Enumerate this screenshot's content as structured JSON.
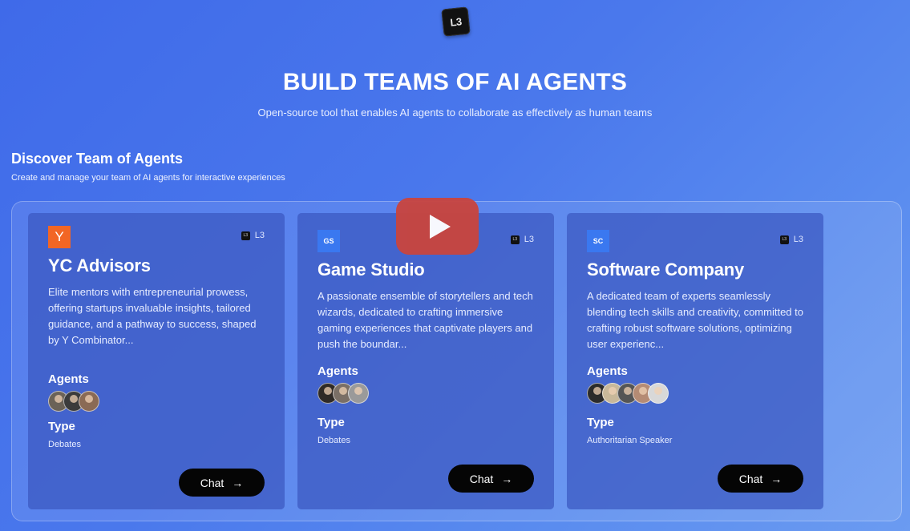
{
  "logo": {
    "text": "L3"
  },
  "hero": {
    "title": "BUILD TEAMS OF AI AGENTS",
    "subtitle": "Open-source tool that enables AI agents to collaborate as effectively as human teams"
  },
  "section": {
    "title": "Discover Team of Agents",
    "subtitle": "Create and manage your team of AI agents for interactive experiences"
  },
  "video": {
    "icon": "play-icon"
  },
  "labels": {
    "agents": "Agents",
    "type": "Type",
    "chat": "Chat",
    "arrow": "→",
    "brand": "L3"
  },
  "cards": [
    {
      "badge": "Y",
      "badge_color": "#f26625",
      "title": "YC Advisors",
      "description": "Elite mentors with entrepreneurial prowess, offering startups invaluable insights, tailored guidance, and a pathway to success, shaped by Y Combinator...",
      "agent_count": 3,
      "type": "Debates"
    },
    {
      "badge": "GS",
      "badge_color": "#3a78f0",
      "title": "Game Studio",
      "description": "A passionate ensemble of storytellers and tech wizards, dedicated to crafting immersive gaming experiences that captivate players and push the boundar...",
      "agent_count": 3,
      "type": "Debates"
    },
    {
      "badge": "SC",
      "badge_color": "#3a78f0",
      "title": "Software Company",
      "description": "A dedicated team of experts seamlessly blending tech skills and creativity, committed to crafting robust software solutions, optimizing user experienc...",
      "agent_count": 5,
      "type": "Authoritarian Speaker"
    }
  ]
}
